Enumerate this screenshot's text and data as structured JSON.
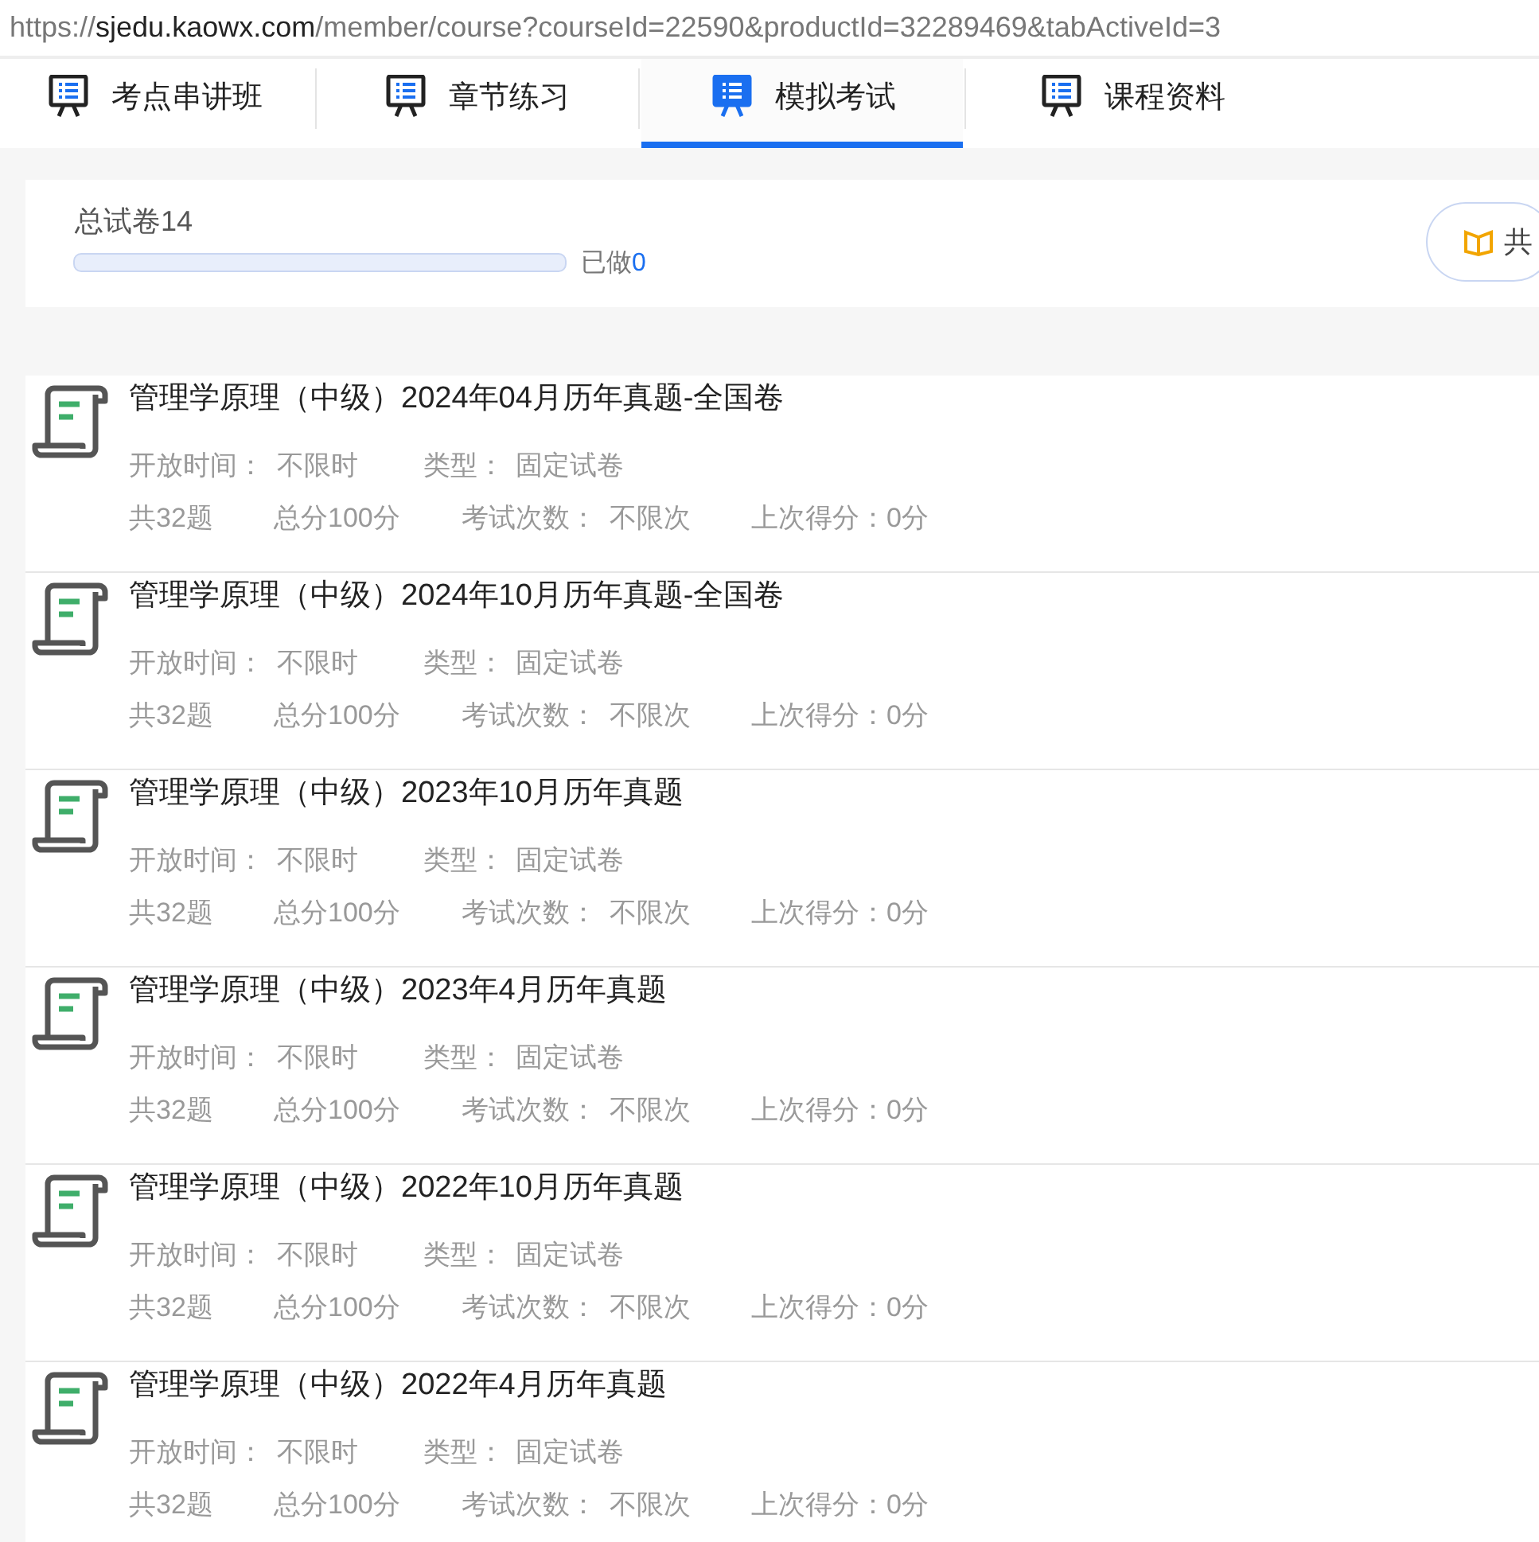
{
  "address_bar": {
    "url_prefix": "https://",
    "url_host": "sjedu.kaowx.com",
    "url_path": "/member/course?courseId=22590&productId=32289469&tabActiveId=3"
  },
  "tabs": [
    {
      "label": "考点串讲班",
      "selected": false
    },
    {
      "label": "章节练习",
      "selected": false
    },
    {
      "label": "模拟考试",
      "selected": true
    },
    {
      "label": "课程资料",
      "selected": false
    }
  ],
  "summary": {
    "total": "总试卷14",
    "level": 0,
    "done_label": "已做",
    "done_count": "0",
    "button": "共"
  },
  "papers": [
    {
      "title": "管理学原理（中级）2024年04月历年真题-全国卷",
      "row_1": [
        "开放时间：",
        "不限时",
        "类型：",
        "固定试卷"
      ],
      "row_2": [
        "共32题",
        "总分100分",
        "考试次数：",
        "不限次",
        "上次得分：0分"
      ]
    },
    {
      "title": "管理学原理（中级）2024年10月历年真题-全国卷",
      "row_1": [
        "开放时间：",
        "不限时",
        "类型：",
        "固定试卷"
      ],
      "row_2": [
        "共32题",
        "总分100分",
        "考试次数：",
        "不限次",
        "上次得分：0分"
      ]
    },
    {
      "title": "管理学原理（中级）2023年10月历年真题",
      "row_1": [
        "开放时间：",
        "不限时",
        "类型：",
        "固定试卷"
      ],
      "row_2": [
        "共32题",
        "总分100分",
        "考试次数：",
        "不限次",
        "上次得分：0分"
      ]
    },
    {
      "title": "管理学原理（中级）2023年4月历年真题",
      "row_1": [
        "开放时间：",
        "不限时",
        "类型：",
        "固定试卷"
      ],
      "row_2": [
        "共32题",
        "总分100分",
        "考试次数：",
        "不限次",
        "上次得分：0分"
      ]
    },
    {
      "title": "管理学原理（中级）2022年10月历年真题",
      "row_1": [
        "开放时间：",
        "不限时",
        "类型：",
        "固定试卷"
      ],
      "row_2": [
        "共32题",
        "总分100分",
        "考试次数：",
        "不限次",
        "上次得分：0分"
      ]
    },
    {
      "title": "管理学原理（中级）2022年4月历年真题",
      "row_1": [
        "开放时间：",
        "不限时",
        "类型：",
        "固定试卷"
      ],
      "row_2": [
        "共32题",
        "总分100分",
        "考试次数：",
        "不限次",
        "上次得分：0分"
      ]
    }
  ]
}
